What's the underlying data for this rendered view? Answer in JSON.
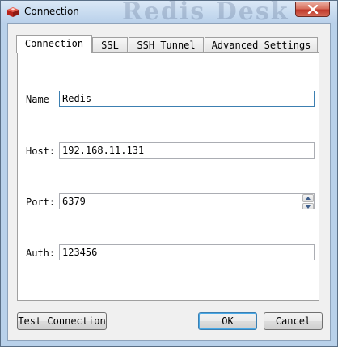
{
  "window": {
    "title": "Connection",
    "background_text": "Redis Desk",
    "close_icon": "close-icon"
  },
  "tabs": [
    {
      "label": "Connection",
      "active": true
    },
    {
      "label": "SSL",
      "active": false
    },
    {
      "label": "SSH Tunnel",
      "active": false
    },
    {
      "label": "Advanced Settings",
      "active": false
    }
  ],
  "form": {
    "name": {
      "label": "Name",
      "value": "Redis"
    },
    "host": {
      "label": "Host:",
      "value": "192.168.11.131"
    },
    "port": {
      "label": "Port:",
      "value": "6379"
    },
    "auth": {
      "label": "Auth:",
      "value": "123456"
    }
  },
  "buttons": {
    "test": "Test Connection",
    "ok": "OK",
    "cancel": "Cancel"
  },
  "colors": {
    "frame": "#b9d1ea",
    "close": "#c0392b",
    "focus": "#3c7fb1"
  }
}
